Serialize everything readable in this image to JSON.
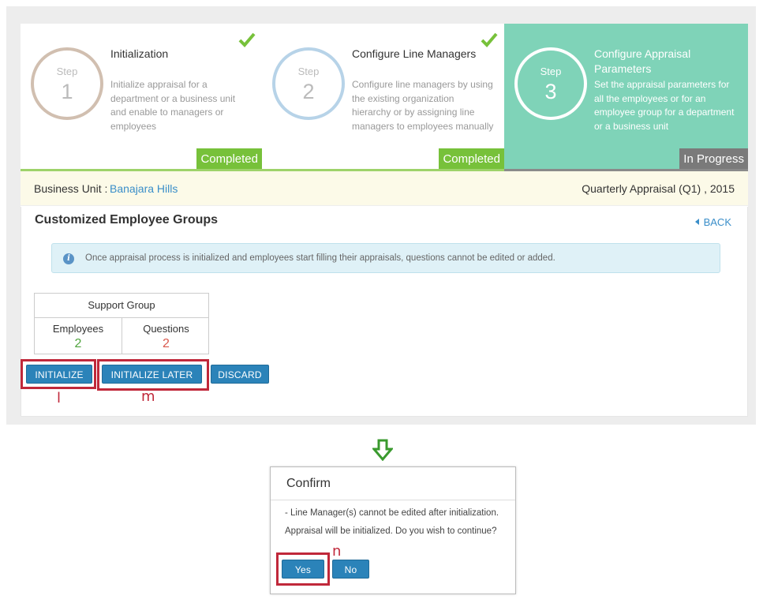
{
  "steps": [
    {
      "step_label": "Step",
      "number": "1",
      "title": "Initialization",
      "description": "Initialize appraisal for a department or a business unit and enable to managers or employees",
      "status": "Completed"
    },
    {
      "step_label": "Step",
      "number": "2",
      "title": "Configure Line Managers",
      "description": "Configure line managers by using the existing organization hierarchy or by assigning line managers to employees manually",
      "status": "Completed"
    },
    {
      "step_label": "Step",
      "number": "3",
      "title": "Configure Appraisal Parameters",
      "description": "Set the appraisal parameters for all the employees or for an employee group for a department or a business unit",
      "status": "In Progress"
    }
  ],
  "business_unit": {
    "label": "Business Unit :",
    "value": "Banajara Hills"
  },
  "period": "Quarterly Appraisal (Q1) , 2015",
  "section": {
    "title": "Customized Employee Groups",
    "back_label": "BACK"
  },
  "info_message": "Once appraisal process is initialized and employees start filling their appraisals, questions cannot be edited or added.",
  "group": {
    "name": "Support Group",
    "employees_label": "Employees",
    "employees_count": "2",
    "questions_label": "Questions",
    "questions_count": "2"
  },
  "actions": {
    "initialize": "INITIALIZE",
    "initialize_later": "INITIALIZE LATER",
    "discard": "DISCARD"
  },
  "annotations": {
    "l": "l",
    "m": "m",
    "n": "n"
  },
  "dialog": {
    "title": "Confirm",
    "line1": "- Line Manager(s) cannot be edited after initialization.",
    "line2": "Appraisal will be initialized. Do you wish to continue?",
    "yes": "Yes",
    "no": "No"
  },
  "colors": {
    "completed": "#77c13a",
    "in_progress_bg": "#7fd3b8",
    "button": "#2b83b9",
    "highlight": "#c0283a",
    "link": "#3a8ec9"
  }
}
